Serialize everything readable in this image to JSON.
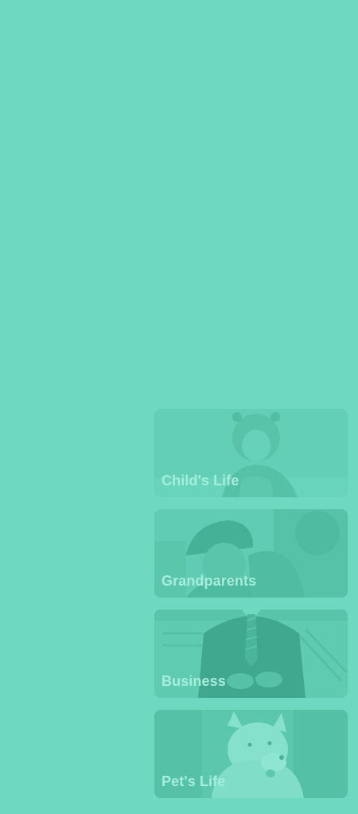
{
  "categories": [
    {
      "label": "Child's Life",
      "image": "toddler-photo"
    },
    {
      "label": "Grandparents",
      "image": "grandparent-photo"
    },
    {
      "label": "Business",
      "image": "businessman-photo"
    },
    {
      "label": "Pet's Life",
      "image": "dog-photo"
    }
  ],
  "colors": {
    "background": "#6ed9c0",
    "card_base": "#62cfb6",
    "label_text": "#a6eddb"
  }
}
